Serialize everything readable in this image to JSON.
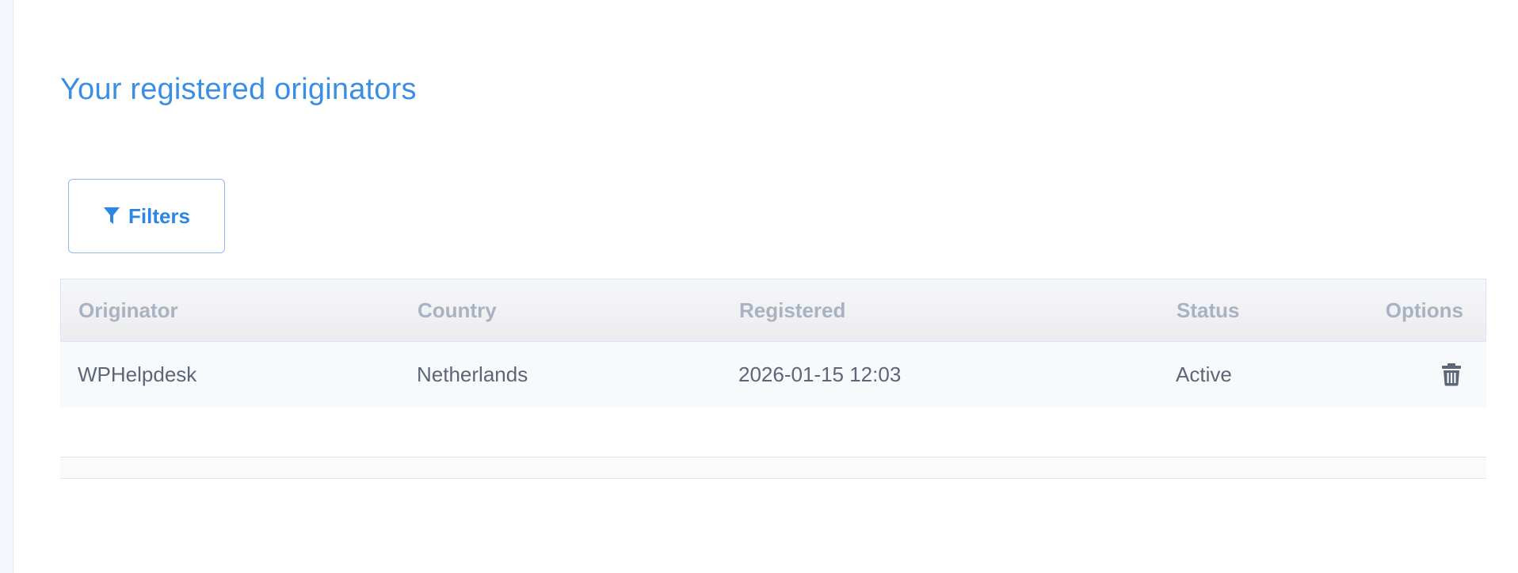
{
  "page": {
    "title": "Your registered originators"
  },
  "toolbar": {
    "filters_label": "Filters",
    "filters_icon": "filter-icon"
  },
  "table": {
    "columns": [
      "Originator",
      "Country",
      "Registered",
      "Status",
      "Options"
    ],
    "rows": [
      {
        "originator": "WPHelpdesk",
        "country": "Netherlands",
        "registered": "2026-01-15 12:03",
        "status": "Active",
        "options_icon": "trash-icon"
      }
    ]
  },
  "colors": {
    "accent": "#3a8ee6",
    "header_text": "#a8b2c1",
    "cell_text": "#5d6677"
  }
}
